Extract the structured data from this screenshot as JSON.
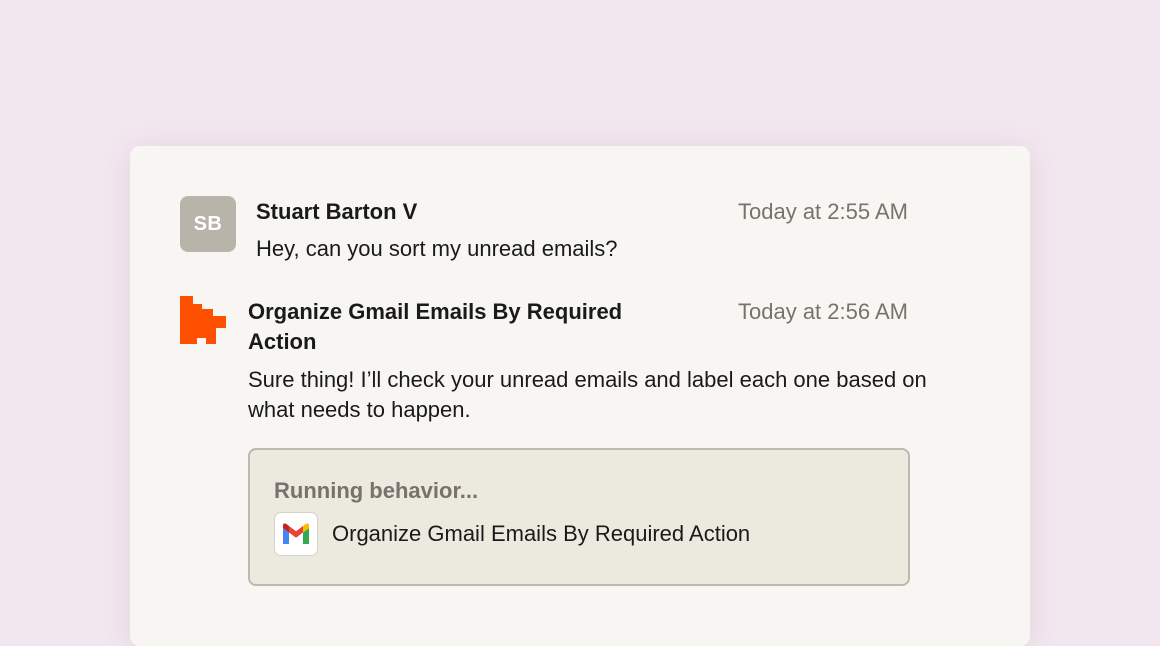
{
  "messages": {
    "user": {
      "avatar_initials": "SB",
      "sender": "Stuart Barton V",
      "timestamp": "Today at 2:55 AM",
      "text": "Hey, can you sort my unread emails?"
    },
    "bot": {
      "logo_icon": "zapier-logo-icon",
      "logo_color": "#ff4f00",
      "sender": "Organize Gmail Emails By Required Action",
      "timestamp": "Today at 2:56 AM",
      "text": "Sure thing! I’ll check your unread emails and label each one based on what needs to happen.",
      "behavior": {
        "status": "Running behavior...",
        "app_icon": "gmail-icon",
        "name": "Organize Gmail Emails By Required Action"
      }
    }
  },
  "colors": {
    "page_background": "#f2e6ef",
    "card_background": "#f8f6f3",
    "avatar_background": "#b8b4aa",
    "behavior_background": "#ece9df",
    "muted_text": "#77736c"
  }
}
